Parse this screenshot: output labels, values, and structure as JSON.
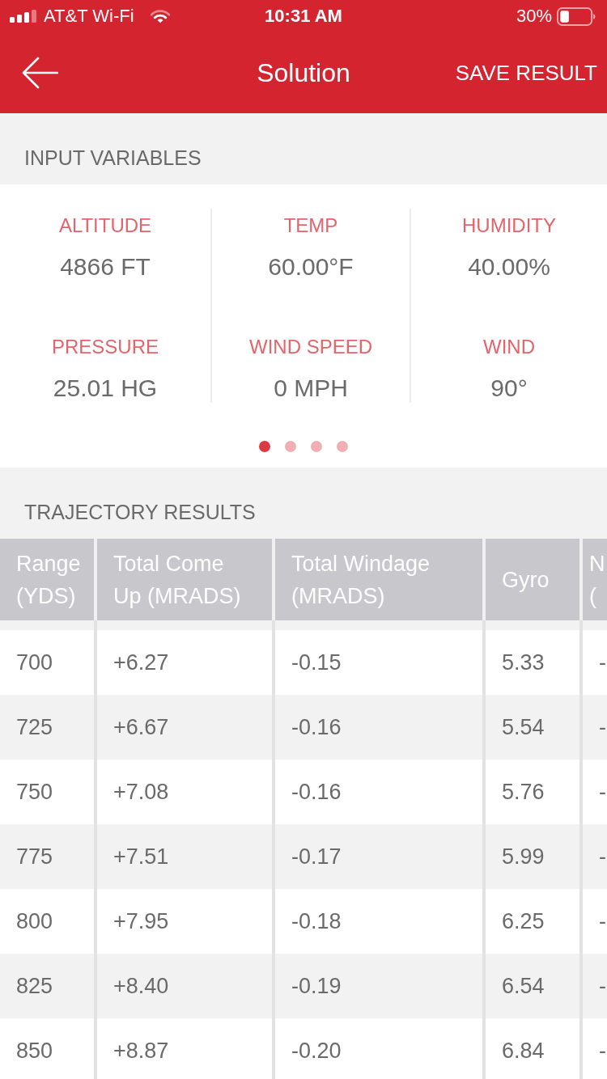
{
  "status_bar": {
    "carrier": "AT&T Wi-Fi",
    "time": "10:31 AM",
    "battery": "30%"
  },
  "nav_bar": {
    "title": "Solution",
    "action": "SAVE RESULT"
  },
  "input_variables": {
    "heading": "INPUT VARIABLES",
    "items": [
      {
        "label": "ALTITUDE",
        "value": "4866 FT"
      },
      {
        "label": "TEMP",
        "value": "60.00°F"
      },
      {
        "label": "HUMIDITY",
        "value": "40.00%"
      },
      {
        "label": "PRESSURE",
        "value": "25.01 HG"
      },
      {
        "label": "WIND SPEED",
        "value": "0 MPH"
      },
      {
        "label": "WIND",
        "value": "90°"
      }
    ],
    "pages": [
      {
        "selected": true
      },
      {
        "selected": false
      },
      {
        "selected": false
      },
      {
        "selected": false
      }
    ]
  },
  "trajectory_results": {
    "heading": "TRAJECTORY RESULTS",
    "columns": [
      "Range (YDS)",
      "Total Come Up (MRADS)",
      "Total Windage (MRADS)",
      "Gyro",
      "N ("
    ],
    "rows": [
      [
        "700",
        "+6.27",
        "-0.15",
        "5.33",
        "-"
      ],
      [
        "725",
        "+6.67",
        "-0.16",
        "5.54",
        "-"
      ],
      [
        "750",
        "+7.08",
        "-0.16",
        "5.76",
        "-"
      ],
      [
        "775",
        "+7.51",
        "-0.17",
        "5.99",
        "-"
      ],
      [
        "800",
        "+7.95",
        "-0.18",
        "6.25",
        "-"
      ],
      [
        "825",
        "+8.40",
        "-0.19",
        "6.54",
        "-"
      ],
      [
        "850",
        "+8.87",
        "-0.20",
        "6.84",
        "-"
      ]
    ]
  }
}
